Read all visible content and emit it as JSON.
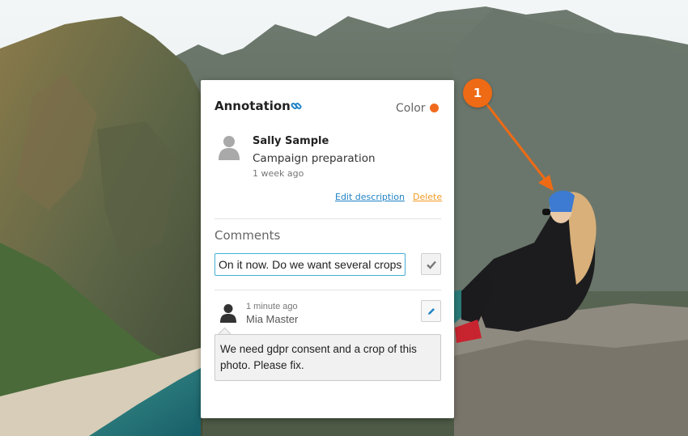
{
  "annotation": {
    "title": "Annotation",
    "color_label": "Color",
    "color": "#f06a1d",
    "author": "Sally Sample",
    "description": "Campaign preparation",
    "time": "1 week ago",
    "edit_description_label": "Edit description",
    "delete_label": "Delete"
  },
  "comments": {
    "heading": "Comments",
    "input_value": "On it now. Do we want several crops?",
    "items": [
      {
        "time": "1 minute ago",
        "author": "Mia Master",
        "text": "We need gdpr consent and a crop of this photo. Please fix."
      }
    ]
  },
  "marker": {
    "number": "1",
    "color": "#ef6a14"
  }
}
